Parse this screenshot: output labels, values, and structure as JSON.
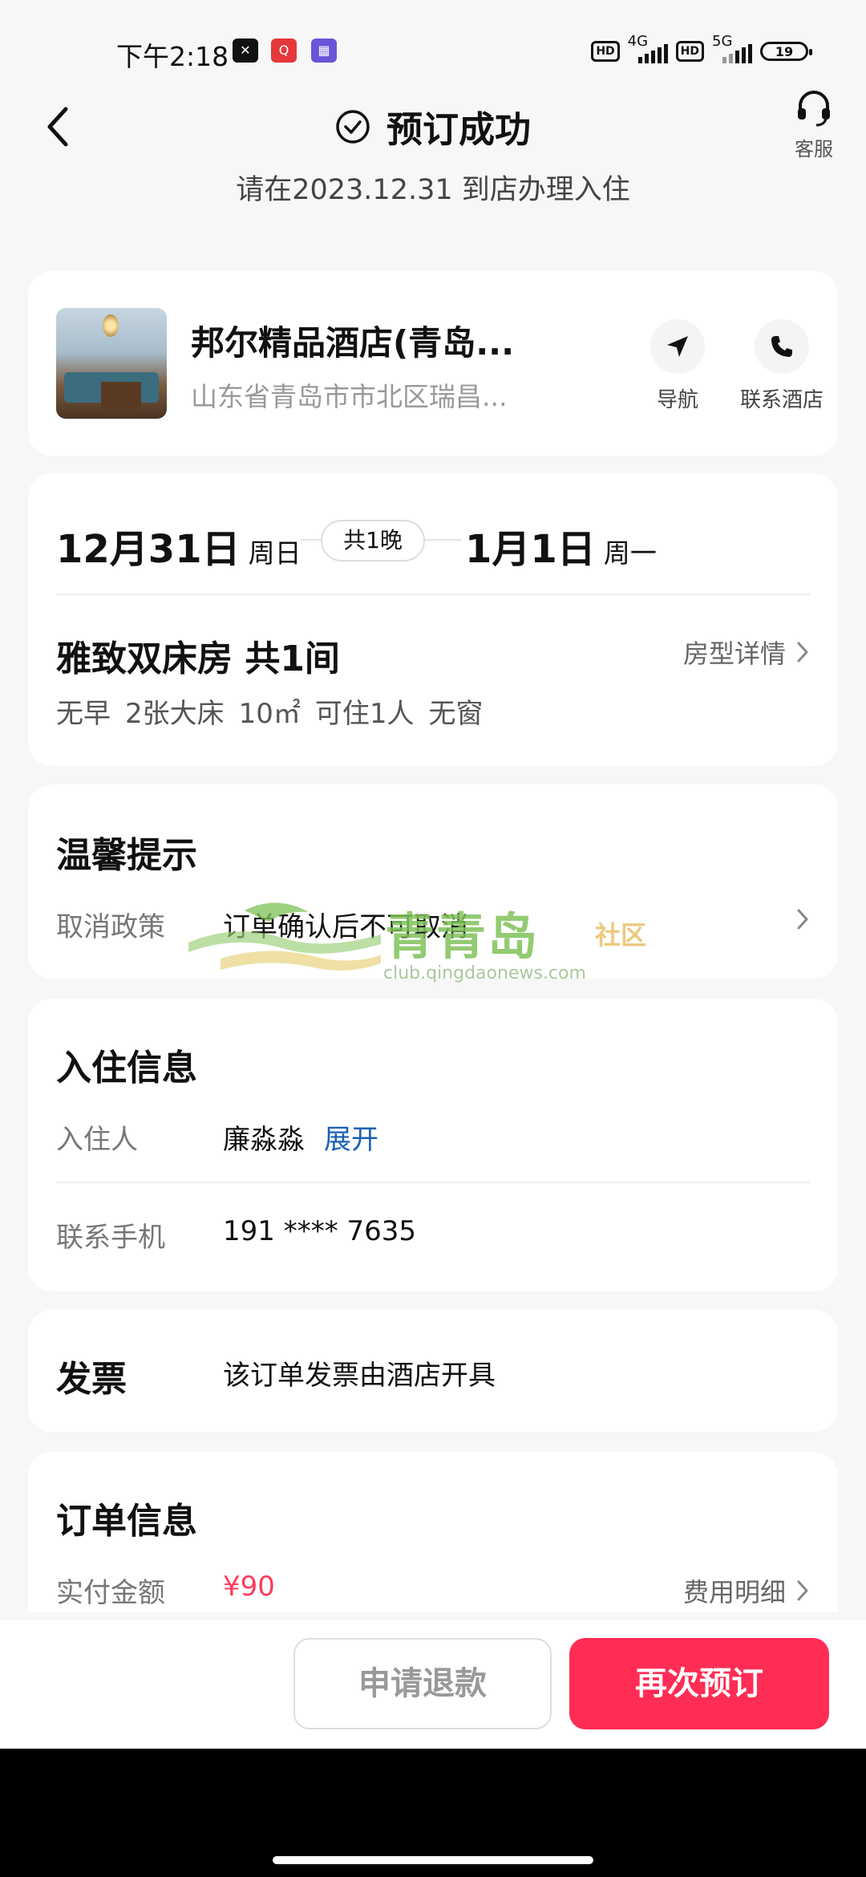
{
  "status_bar": {
    "time": "下午2:18",
    "hd1": "HD",
    "net1": "4G",
    "hd2": "HD",
    "net2": "5G",
    "battery": "19"
  },
  "header": {
    "title": "预订成功",
    "subtitle": "请在2023.12.31 到店办理入住",
    "service_label": "客服"
  },
  "hotel": {
    "name": "邦尔精品酒店(青岛...",
    "address": "山东省青岛市市北区瑞昌...",
    "nav_label": "导航",
    "call_label": "联系酒店"
  },
  "stay": {
    "checkin_date": "12月31日",
    "checkin_weekday": "周日",
    "nights": "共1晚",
    "checkout_date": "1月1日",
    "checkout_weekday": "周一",
    "room": "雅致双床房 共1间",
    "room_detail": "房型详情",
    "features": [
      "无早",
      "2张大床",
      "10㎡",
      "可住1人",
      "无窗"
    ]
  },
  "tips": {
    "title": "温馨提示",
    "label": "取消政策",
    "value": "订单确认后不可取消"
  },
  "watermark": {
    "brand": "青青岛",
    "community": "社区",
    "url": "club.qingdaonews.com"
  },
  "guest": {
    "title": "入住信息",
    "guest_label": "入住人",
    "guest_name": "廉淼淼",
    "expand": "展开",
    "phone_label": "联系手机",
    "phone": "191 **** 7635"
  },
  "invoice": {
    "title": "发票",
    "text": "该订单发票由酒店开具"
  },
  "order": {
    "title": "订单信息",
    "paid_label": "实付金额",
    "paid_amount": "¥90",
    "fee_detail": "费用明细"
  },
  "actions": {
    "refund": "申请退款",
    "rebook": "再次预订"
  },
  "colors": {
    "accent": "#ff2d55",
    "price": "#ff3b5c",
    "link": "#1a5fb4"
  }
}
